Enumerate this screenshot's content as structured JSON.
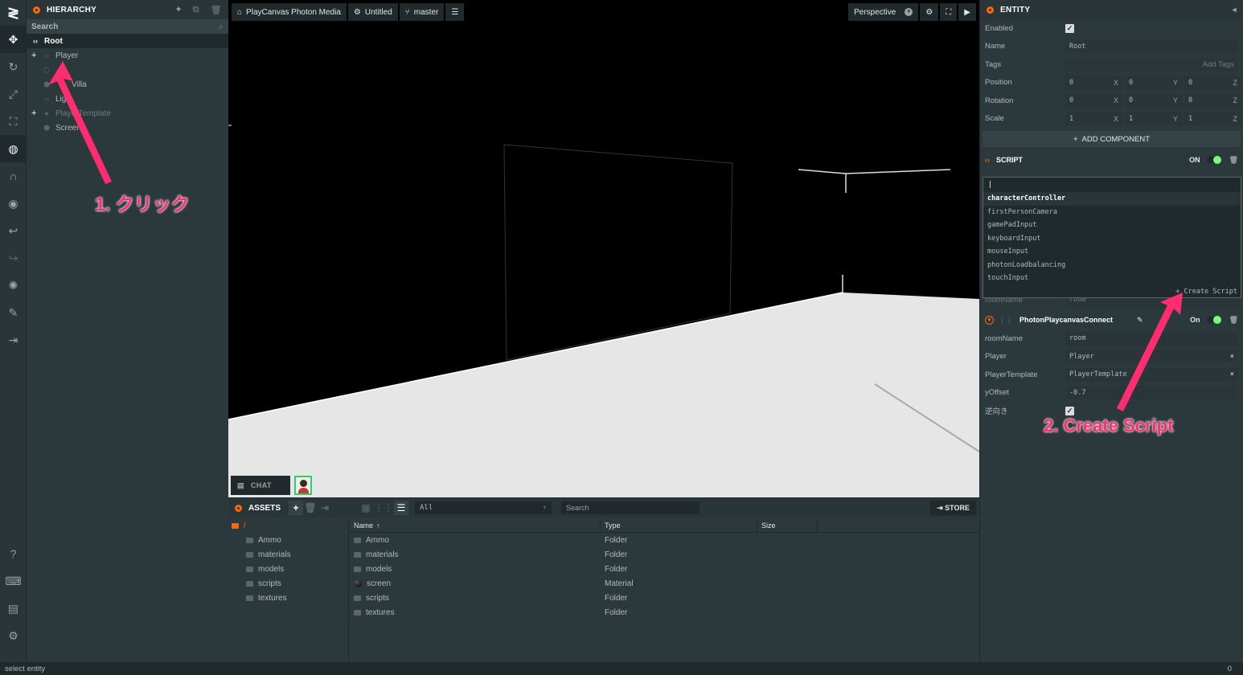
{
  "toolbar": {
    "items": [
      "translate-icon",
      "rotate-icon",
      "scale-icon",
      "resize-icon",
      "world-icon",
      "magnet-icon",
      "eye-icon",
      "undo-icon",
      "redo-icon",
      "bulb-icon",
      "edit-icon",
      "import-icon"
    ],
    "bottom": [
      "help-icon",
      "keyboard-icon",
      "chat-icon",
      "settings-icon"
    ]
  },
  "hierarchy": {
    "title": "HIERARCHY",
    "search_label": "Search",
    "root": "Root",
    "items": [
      {
        "label": "Player",
        "expand": "+"
      },
      {
        "label": ""
      },
      {
        "label": "Villa"
      },
      {
        "label": "Ligh"
      },
      {
        "label": "PlayerTemplate",
        "expand": "+"
      },
      {
        "label": "Screen"
      }
    ]
  },
  "viewport": {
    "project": "PlayCanvas Photon Media",
    "scene": "Untitled",
    "branch": "master",
    "camera": "Perspective",
    "chat": "CHAT"
  },
  "assets": {
    "title": "ASSETS",
    "filter": "All",
    "search_placeholder": "Search",
    "store": "STORE",
    "root_folder": "/",
    "folders": [
      "Ammo",
      "materials",
      "models",
      "scripts",
      "textures"
    ],
    "columns": [
      "Name",
      "Type",
      "Size"
    ],
    "sort_indicator": "↑",
    "rows": [
      {
        "name": "Ammo",
        "type": "Folder"
      },
      {
        "name": "materials",
        "type": "Folder"
      },
      {
        "name": "models",
        "type": "Folder"
      },
      {
        "name": "screen",
        "type": "Material"
      },
      {
        "name": "scripts",
        "type": "Folder"
      },
      {
        "name": "textures",
        "type": "Folder"
      }
    ]
  },
  "inspector": {
    "title": "ENTITY",
    "enabled_label": "Enabled",
    "name_label": "Name",
    "name_value": "Root",
    "tags_label": "Tags",
    "tags_placeholder": "Add Tags",
    "position_label": "Position",
    "position": [
      "0",
      "0",
      "0"
    ],
    "rotation_label": "Rotation",
    "rotation": [
      "0",
      "0",
      "0"
    ],
    "scale_label": "Scale",
    "scale": [
      "1",
      "1",
      "1"
    ],
    "axes": [
      "X",
      "Y",
      "Z"
    ],
    "add_component": "ADD COMPONENT",
    "script_header": "SCRIPT",
    "script_state": "ON",
    "dropdown_items": [
      "characterController",
      "firstPersonCamera",
      "gamePadInput",
      "keyboardInput",
      "mouseInput",
      "photonLoadbalancing",
      "touchInput"
    ],
    "create_script": "Create Script",
    "hidden_row_label": "roomName",
    "hidden_row_value": "room",
    "component_name": "PhotonPlaycanvasConnect",
    "component_state": "On",
    "attrs": [
      {
        "label": "roomName",
        "value": "room",
        "clear": ""
      },
      {
        "label": "Player",
        "value": "Player",
        "clear": "×"
      },
      {
        "label": "PlayerTemplate",
        "value": "PlayerTemplate",
        "clear": "×"
      },
      {
        "label": "yOffset",
        "value": "-0.7",
        "clear": ""
      }
    ],
    "reverse_label": "逆向き"
  },
  "annotations": {
    "step1": "1. クリック",
    "step2": "2. Create Script"
  },
  "status": {
    "text": "select entity",
    "count": "0"
  },
  "colors": {
    "accent": "#ff6600",
    "annotation": "#ff2d6f",
    "toggle_on": "#77ff77"
  }
}
